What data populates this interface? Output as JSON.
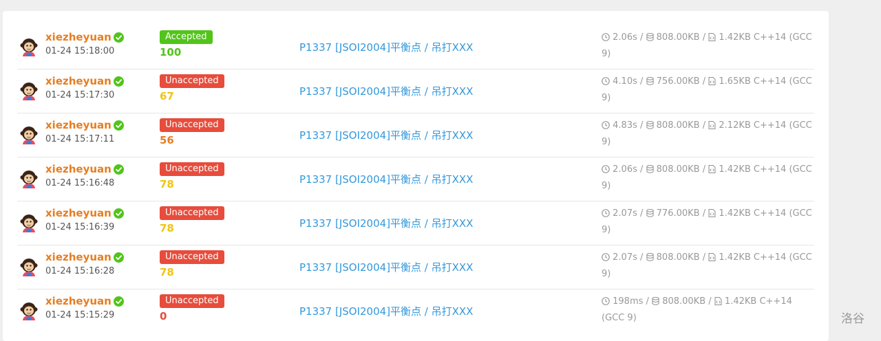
{
  "records": [
    {
      "user": "xiezheyuan",
      "time": "01-24 15:18:00",
      "status": "Accepted",
      "status_color": "#52c41a",
      "score": "100",
      "score_color": "#52c41a",
      "problem": "P1337 [JSOI2004]平衡点 / 吊打XXX",
      "runtime": "2.06s",
      "memory": "808.00KB",
      "code_size": "1.42KB",
      "lang": "C++14 (GCC 9)"
    },
    {
      "user": "xiezheyuan",
      "time": "01-24 15:17:30",
      "status": "Unaccepted",
      "status_color": "#e74c3c",
      "score": "67",
      "score_color": "#f1c40f",
      "problem": "P1337 [JSOI2004]平衡点 / 吊打XXX",
      "runtime": "4.10s",
      "memory": "756.00KB",
      "code_size": "1.65KB",
      "lang": "C++14 (GCC 9)"
    },
    {
      "user": "xiezheyuan",
      "time": "01-24 15:17:11",
      "status": "Unaccepted",
      "status_color": "#e74c3c",
      "score": "56",
      "score_color": "#e67e22",
      "problem": "P1337 [JSOI2004]平衡点 / 吊打XXX",
      "runtime": "4.83s",
      "memory": "808.00KB",
      "code_size": "2.12KB",
      "lang": "C++14 (GCC 9)"
    },
    {
      "user": "xiezheyuan",
      "time": "01-24 15:16:48",
      "status": "Unaccepted",
      "status_color": "#e74c3c",
      "score": "78",
      "score_color": "#f1c40f",
      "problem": "P1337 [JSOI2004]平衡点 / 吊打XXX",
      "runtime": "2.06s",
      "memory": "808.00KB",
      "code_size": "1.42KB",
      "lang": "C++14 (GCC 9)"
    },
    {
      "user": "xiezheyuan",
      "time": "01-24 15:16:39",
      "status": "Unaccepted",
      "status_color": "#e74c3c",
      "score": "78",
      "score_color": "#f1c40f",
      "problem": "P1337 [JSOI2004]平衡点 / 吊打XXX",
      "runtime": "2.07s",
      "memory": "776.00KB",
      "code_size": "1.42KB",
      "lang": "C++14 (GCC 9)"
    },
    {
      "user": "xiezheyuan",
      "time": "01-24 15:16:28",
      "status": "Unaccepted",
      "status_color": "#e74c3c",
      "score": "78",
      "score_color": "#f1c40f",
      "problem": "P1337 [JSOI2004]平衡点 / 吊打XXX",
      "runtime": "2.07s",
      "memory": "808.00KB",
      "code_size": "1.42KB",
      "lang": "C++14 (GCC 9)"
    },
    {
      "user": "xiezheyuan",
      "time": "01-24 15:15:29",
      "status": "Unaccepted",
      "status_color": "#e74c3c",
      "score": "0",
      "score_color": "#e74c3c",
      "problem": "P1337 [JSOI2004]平衡点 / 吊打XXX",
      "runtime": "198ms",
      "memory": "808.00KB",
      "code_size": "1.42KB",
      "lang": "C++14 (GCC 9)"
    }
  ],
  "watermark": "洛谷",
  "icons": {
    "verified": "check-circle-icon",
    "runtime": "clock-icon",
    "memory": "database-icon",
    "code": "file-code-icon"
  },
  "colors": {
    "username": "#e67e22",
    "link": "#3498db",
    "verified": "#52c41a"
  }
}
